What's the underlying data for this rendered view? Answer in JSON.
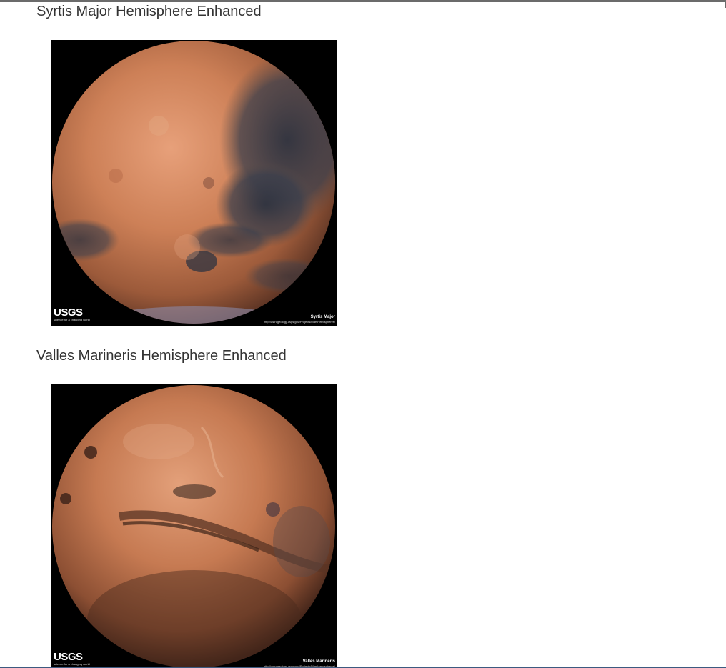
{
  "hemispheres": [
    {
      "title": "Syrtis Major Hemisphere Enhanced",
      "caption": "Syrtis Major",
      "caption_url": "http://astrogeology.usgs.gov/Projects/MarsHemispheres/",
      "logo_text": "USGS",
      "logo_tagline": "science for a changing world"
    },
    {
      "title": "Valles Marineris Hemisphere Enhanced",
      "caption": "Valles Marineris",
      "caption_url": "http://astrogeology.usgs.gov/Projects/MarsHemispheres/",
      "logo_text": "USGS",
      "logo_tagline": "science for a changing world"
    }
  ],
  "colors": {
    "title_text": "#333333",
    "image_background": "#000000",
    "mars_base": "#c8784f",
    "mars_dark": "#3a3c44"
  }
}
